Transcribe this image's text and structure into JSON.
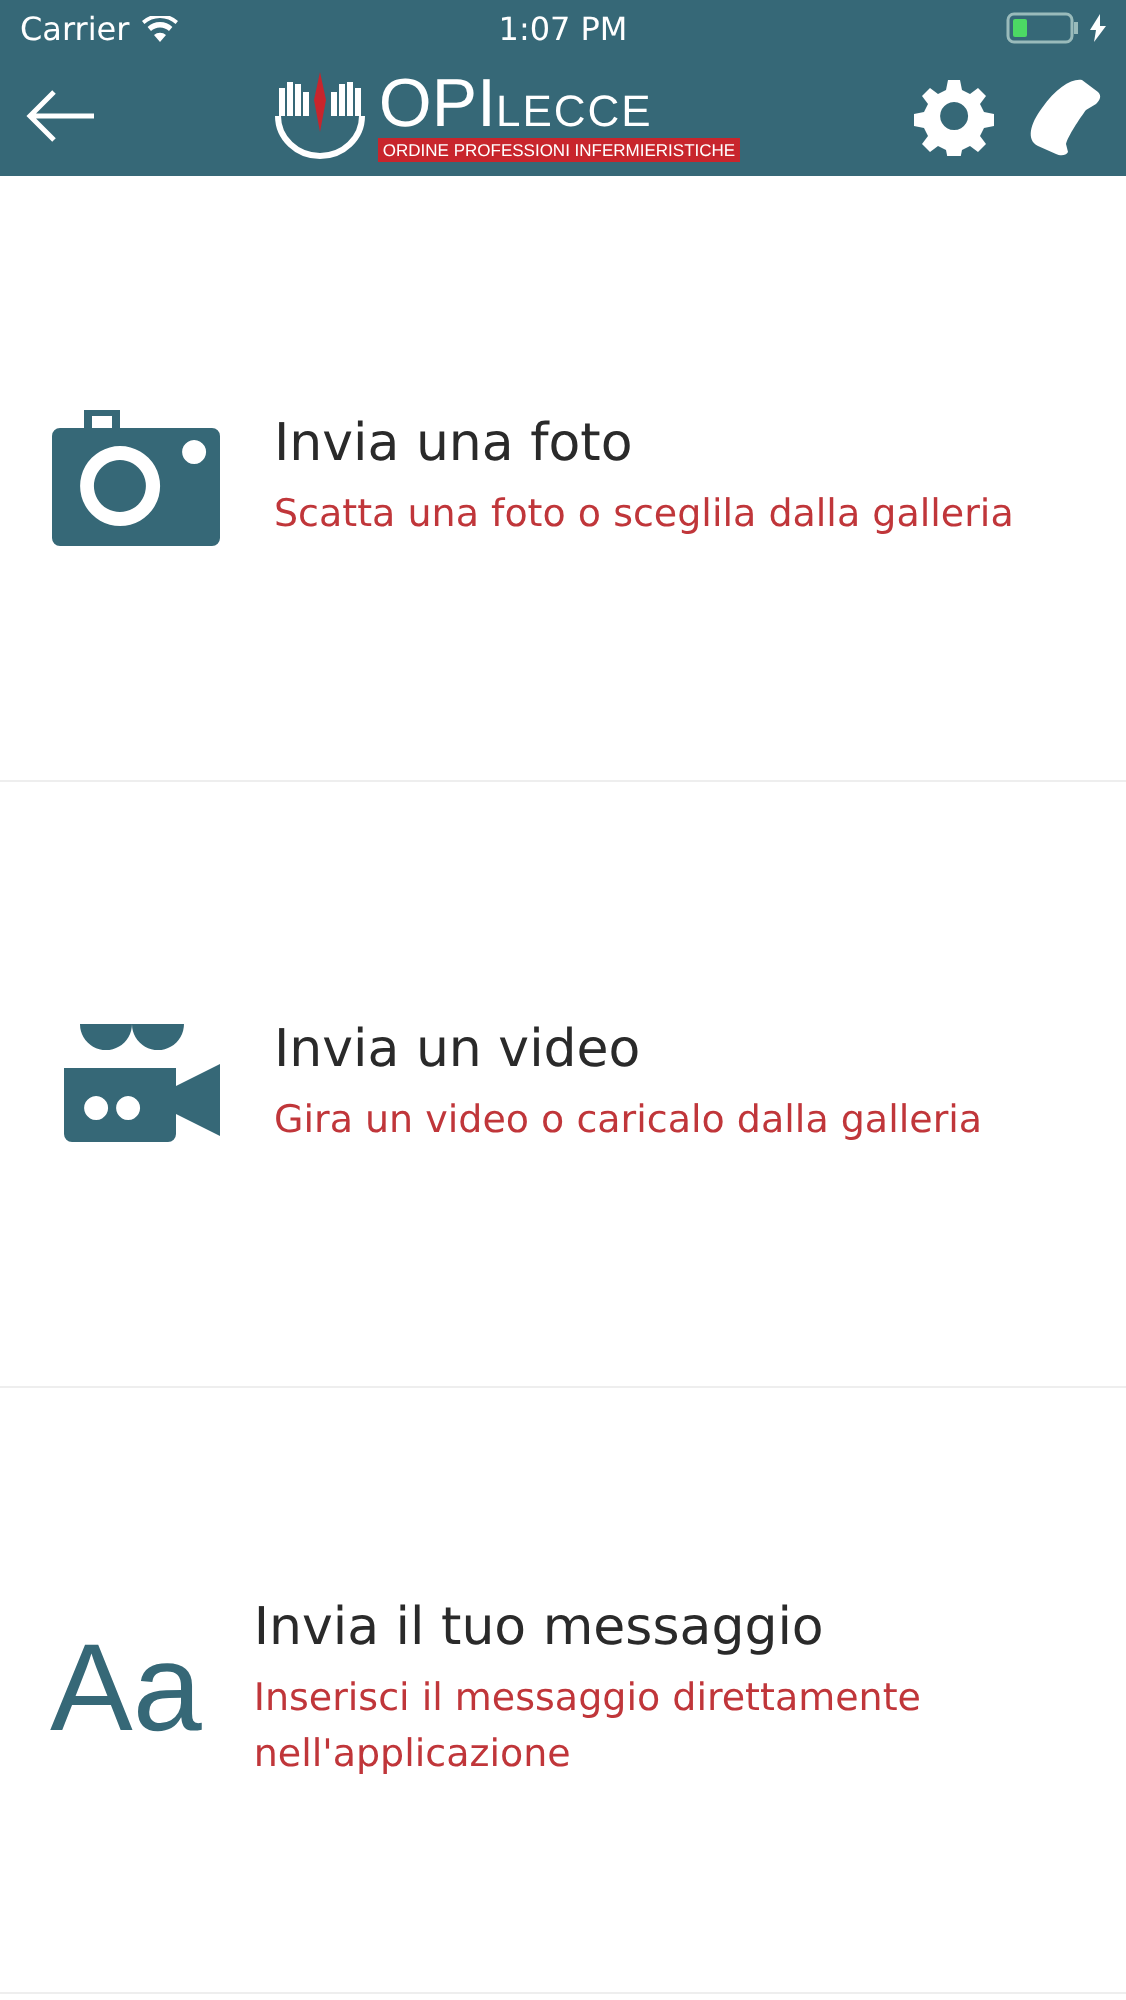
{
  "status_bar": {
    "carrier": "Carrier",
    "time": "1:07 PM"
  },
  "header": {
    "logo": {
      "main": "OPI",
      "city": "LECCE",
      "subtitle": "ORDINE PROFESSIONI INFERMIERISTICHE"
    }
  },
  "items": [
    {
      "kind": "camera",
      "title": "Invia una foto",
      "subtitle": "Scatta una foto o sceglila dalla galleria"
    },
    {
      "kind": "video",
      "title": "Invia un video",
      "subtitle": "Gira un video o caricalo dalla galleria"
    },
    {
      "kind": "text",
      "glyph": "Aa",
      "title": "Invia il tuo messaggio",
      "subtitle": "Inserisci il messaggio direttamente nell'applicazione"
    }
  ]
}
